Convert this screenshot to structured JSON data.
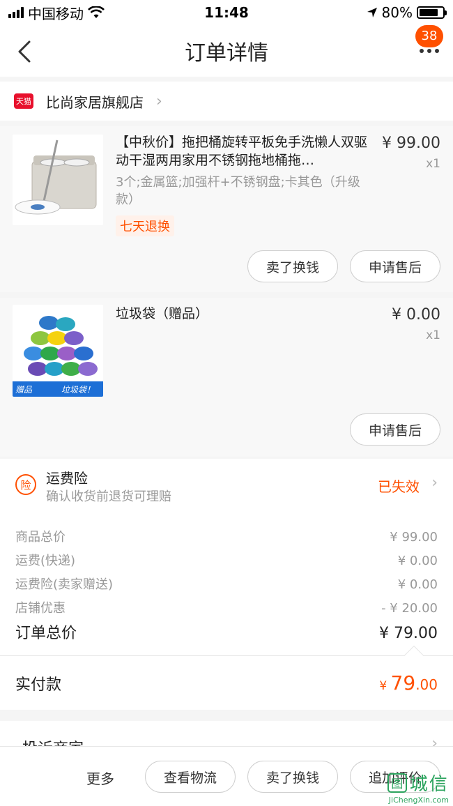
{
  "status_bar": {
    "carrier": "中国移动",
    "time": "11:48",
    "battery": "80%",
    "battery_level": 0.8,
    "icons": [
      "signal-icon",
      "wifi-icon",
      "location-icon",
      "battery-icon"
    ]
  },
  "nav": {
    "title": "订单详情",
    "badge": "38",
    "icons": [
      "back-icon",
      "more-icon"
    ]
  },
  "store": {
    "badge": "天猫",
    "name": "比尚家居旗舰店"
  },
  "items": [
    {
      "title": "【中秋价】拖把桶旋转平板免手洗懒人双驱动干湿两用家用不锈钢拖地桶拖…",
      "sku": "3个;金属篮;加强杆+不锈钢盘;卡其色（升级款）",
      "price": "¥ 99.00",
      "qty": "x1",
      "tag": "七天退换",
      "buttons": [
        "卖了换钱",
        "申请售后"
      ]
    },
    {
      "title": "垃圾袋（赠品）",
      "price": "¥ 0.00",
      "qty": "x1",
      "thumb_caption_left": "赠品",
      "thumb_caption_right": "垃圾袋！",
      "buttons": [
        "申请售后"
      ]
    }
  ],
  "insurance": {
    "icon_char": "险",
    "title": "运费险",
    "subtitle": "确认收货前退货可理赔",
    "status": "已失效"
  },
  "summary": {
    "rows": [
      {
        "label": "商品总价",
        "value": "¥ 99.00"
      },
      {
        "label": "运费(快递)",
        "value": "¥ 0.00"
      },
      {
        "label": "运费险(卖家赠送)",
        "value": "¥ 0.00"
      },
      {
        "label": "店铺优惠",
        "value": "- ¥ 20.00"
      }
    ],
    "total_label": "订单总价",
    "total_value": "¥ 79.00"
  },
  "paid": {
    "label": "实付款",
    "currency": "¥",
    "integer": "79",
    "decimal": ".00"
  },
  "complaint": {
    "label": "投诉商家"
  },
  "bottom_bar": {
    "more": "更多",
    "buttons": [
      "查看物流",
      "卖了换钱",
      "追加评价"
    ]
  },
  "watermark": {
    "logo_char": "图",
    "text": "城信",
    "url": "JiChengXin.com"
  },
  "colors": {
    "accent": "#ff5000",
    "tmall_red": "#e8102c",
    "watermark_green": "#2aa35d"
  }
}
